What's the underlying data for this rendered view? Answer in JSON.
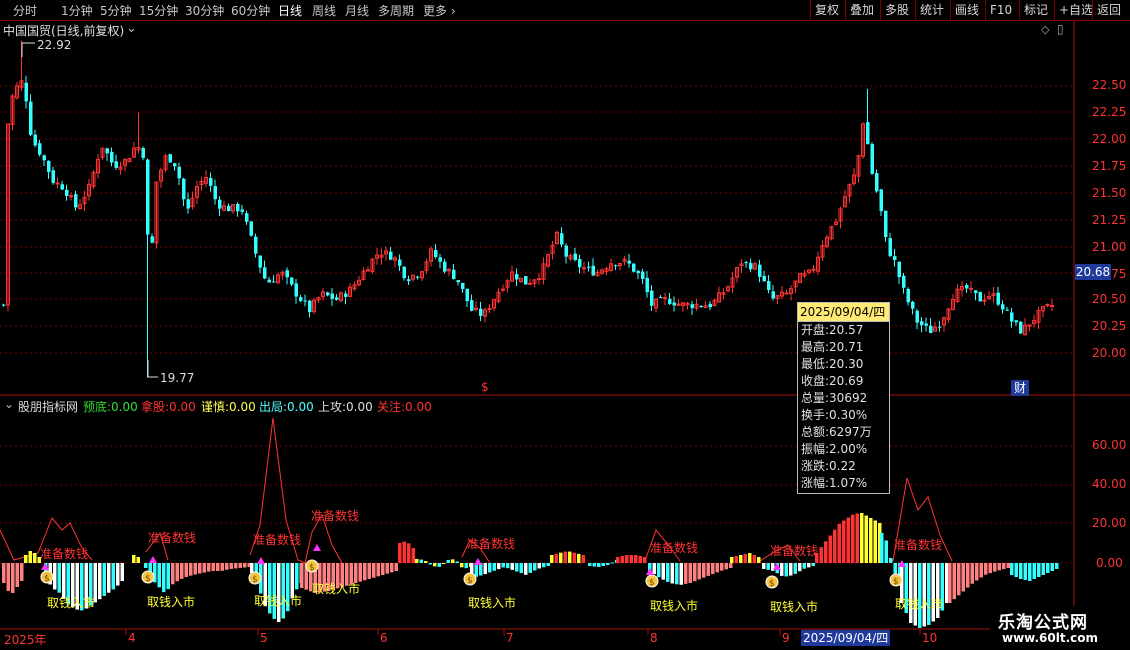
{
  "toolbar": {
    "periods": [
      "分时",
      "1分钟",
      "5分钟",
      "15分钟",
      "30分钟",
      "60分钟",
      "日线",
      "周线",
      "月线",
      "多周期",
      "更多 ›"
    ],
    "active_period": "日线",
    "right_buttons": [
      "复权",
      "叠加",
      "多股",
      "统计",
      "画线",
      "F10",
      "标记",
      "+自选",
      "返回"
    ]
  },
  "main_chart": {
    "title": "中国国贸(日线,前复权)",
    "high_marker": "22.92",
    "low_marker": "19.77",
    "price_ticks": [
      "22.50",
      "22.25",
      "22.00",
      "21.75",
      "21.50",
      "21.25",
      "21.00",
      "20.75",
      "20.50",
      "20.25",
      "20.00"
    ],
    "current_price": "20.68",
    "event_marker_dollar": "$",
    "event_marker_finance": "财"
  },
  "indicator": {
    "name": "股朋指标网",
    "items": [
      {
        "label": "预底:",
        "value": "0.00",
        "color": "#33dd33"
      },
      {
        "label": "拿股:",
        "value": "0.00",
        "color": "#ff3333"
      },
      {
        "label": "谨慎:",
        "value": "0.00",
        "color": "#ffff55"
      },
      {
        "label": "出局:",
        "value": "0.00",
        "color": "#55ffff"
      },
      {
        "label": "上攻:",
        "value": "0.00",
        "color": "#dddddd"
      },
      {
        "label": "关注:",
        "value": "0.00",
        "color": "#ff3333"
      }
    ],
    "ticks": [
      "60.00",
      "40.00",
      "20.00",
      "0.00"
    ],
    "label_prepare": "准备数钱",
    "label_take": "取钱入市"
  },
  "date_axis": {
    "labels": [
      "2025年",
      "4",
      "5",
      "6",
      "7",
      "8",
      "9",
      "10"
    ],
    "highlight": "2025/09/04/四"
  },
  "tooltip": {
    "header": "2025/09/04/四",
    "rows": [
      "开盘:20.57",
      "最高:20.71",
      "最低:20.30",
      "收盘:20.69",
      "总量:30692",
      "换手:0.30%",
      "总额:6297万",
      "振幅:2.00%",
      "涨跌:0.22",
      "涨幅:1.07%"
    ]
  },
  "watermark": {
    "name": "乐淘公式网",
    "url": "www.60lt.com"
  },
  "colors": {
    "up": "#ff3333",
    "down": "#33ffff",
    "grid": "#7a0000",
    "axis": "#aa1111",
    "yellow": "#ffff33",
    "pink": "#ff8080",
    "white": "#ffffff"
  }
}
